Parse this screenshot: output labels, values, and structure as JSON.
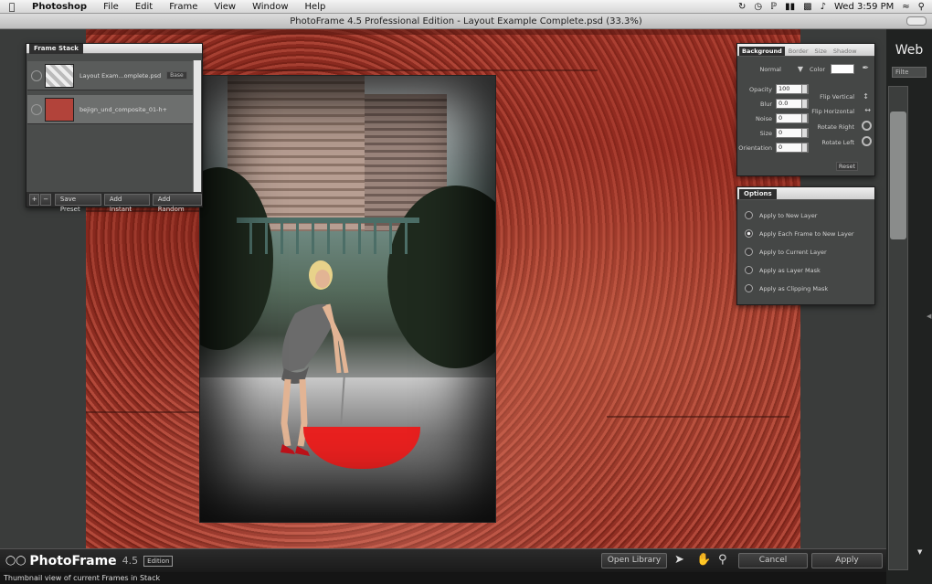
{
  "menubar": {
    "items": [
      "Photoshop",
      "File",
      "Edit",
      "Frame",
      "View",
      "Window",
      "Help"
    ],
    "clock": "Wed 3:59 PM"
  },
  "window": {
    "title": "PhotoFrame 4.5 Professional Edition - Layout Example Complete.psd (33.3%)"
  },
  "frame_stack": {
    "title": "Frame Stack",
    "rows": [
      {
        "name": "Layout Exam...omplete.psd",
        "badge": "Base"
      },
      {
        "name": "bejign_und_composite_01-h+"
      }
    ],
    "buttons": {
      "add": "+",
      "remove": "−",
      "save_preset": "Save Preset",
      "add_instant": "Add Instant",
      "add_random": "Add Random"
    }
  },
  "background_panel": {
    "tabs": [
      "Background",
      "Border",
      "Size",
      "Shadow"
    ],
    "mode": "Normal",
    "color_label": "Color",
    "fields": [
      {
        "label": "Opacity",
        "value": "100"
      },
      {
        "label": "Blur",
        "value": "0.0"
      },
      {
        "label": "Noise",
        "value": "0"
      },
      {
        "label": "Size",
        "value": "0"
      },
      {
        "label": "Orientation",
        "value": "0"
      }
    ],
    "toggles": [
      "Flip Vertical",
      "Flip Horizontal",
      "Rotate Right",
      "Rotate Left"
    ],
    "reset_label": "Reset"
  },
  "options_panel": {
    "title": "Options",
    "options": [
      {
        "label": "Apply to New Layer",
        "selected": false
      },
      {
        "label": "Apply Each Frame to New Layer",
        "selected": true
      },
      {
        "label": "Apply to Current Layer",
        "selected": false
      },
      {
        "label": "Apply as Layer Mask",
        "selected": false
      },
      {
        "label": "Apply as Clipping Mask",
        "selected": false
      }
    ]
  },
  "side_strip": {
    "title": "Web",
    "filter": "Filte"
  },
  "bottom": {
    "logo": "PhotoFrame",
    "version": "4.5",
    "edition": "Edition",
    "open_library": "Open Library",
    "cancel": "Cancel",
    "apply": "Apply"
  },
  "status": "Thumbnail view of current Frames in Stack"
}
